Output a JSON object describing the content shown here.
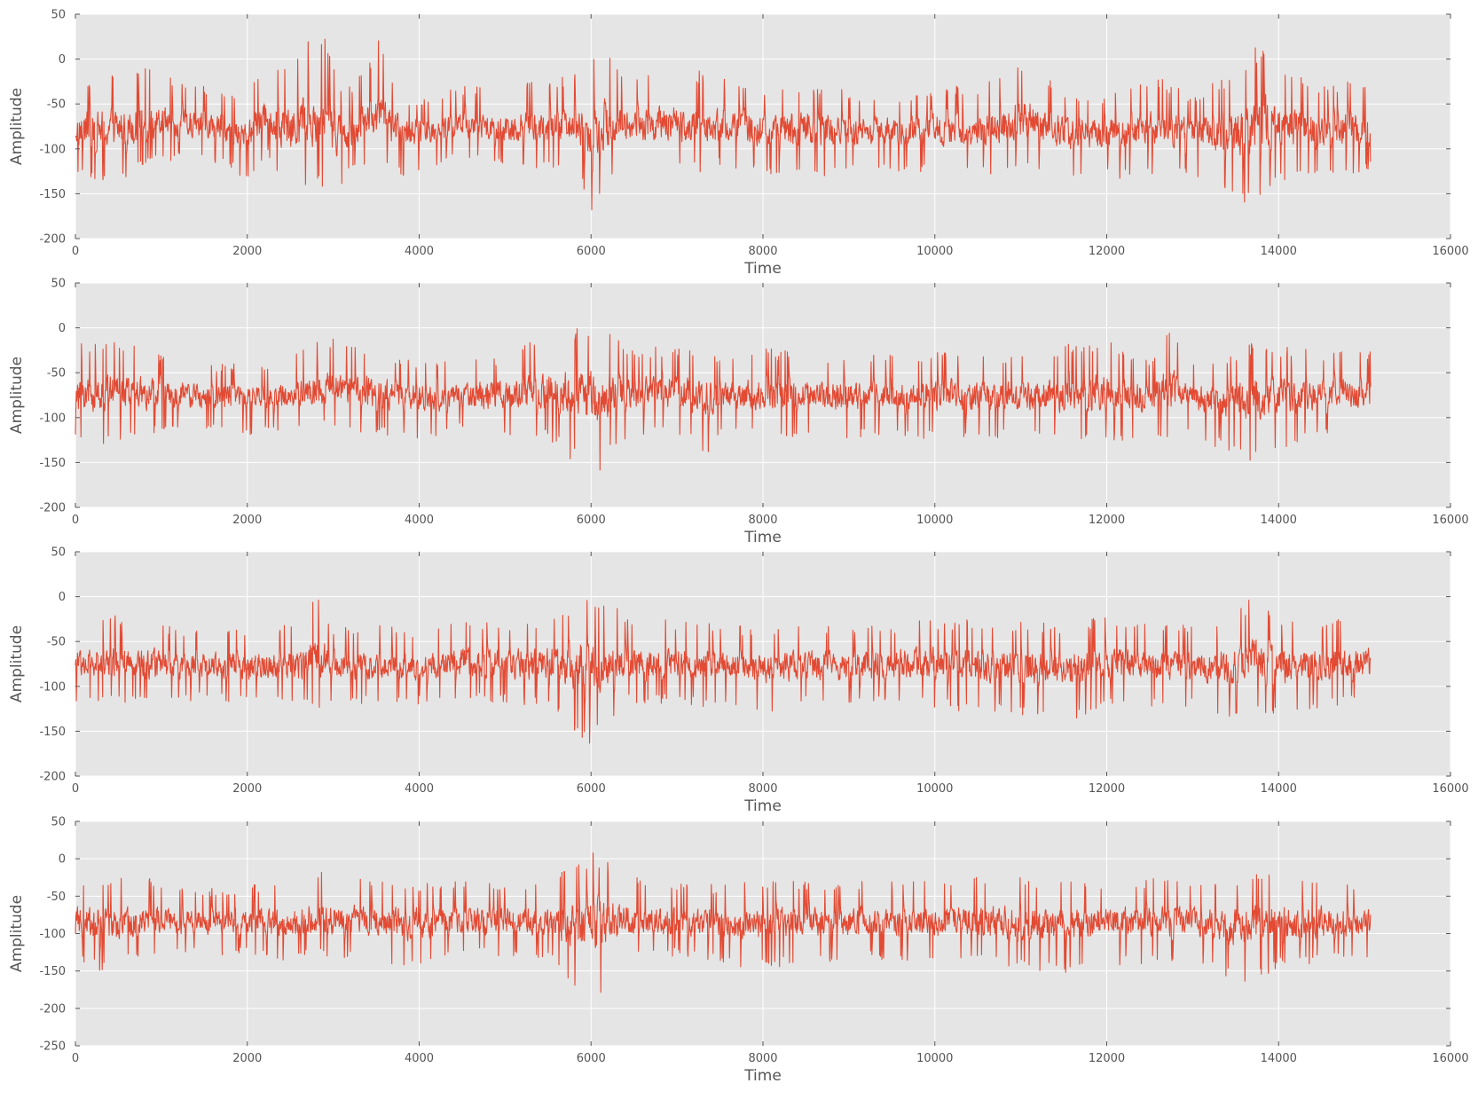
{
  "chart_data": [
    {
      "type": "line",
      "title": "",
      "xlabel": "Time",
      "ylabel": "Amplitude",
      "xlim": [
        0,
        16000
      ],
      "ylim": [
        -200,
        50
      ],
      "x_ticks": [
        0,
        2000,
        4000,
        6000,
        8000,
        10000,
        12000,
        14000,
        16000
      ],
      "y_ticks": [
        -200,
        -150,
        -100,
        -50,
        0,
        50
      ],
      "grid": true,
      "color": "#e24a33",
      "series": [
        {
          "x_range": [
            0,
            15070
          ],
          "baseline": -78,
          "envelope": [
            [
              0,
              -130,
              -28
            ],
            [
              500,
              -145,
              -8
            ],
            [
              800,
              -120,
              -10
            ],
            [
              1500,
              -110,
              -30
            ],
            [
              2000,
              -135,
              -40
            ],
            [
              2250,
              -110,
              15
            ],
            [
              2500,
              -150,
              -20
            ],
            [
              2700,
              -140,
              40
            ],
            [
              2850,
              -140,
              40
            ],
            [
              3050,
              -160,
              -20
            ],
            [
              3250,
              -120,
              -30
            ],
            [
              3520,
              -120,
              25
            ],
            [
              3800,
              -130,
              -40
            ],
            [
              4000,
              -125,
              -45
            ],
            [
              4500,
              -110,
              -30
            ],
            [
              5000,
              -120,
              -30
            ],
            [
              5500,
              -125,
              -20
            ],
            [
              5800,
              -120,
              -15
            ],
            [
              6020,
              -185,
              -10
            ],
            [
              6060,
              -160,
              20
            ],
            [
              6400,
              -120,
              -20
            ],
            [
              6950,
              -120,
              -10
            ],
            [
              7450,
              -130,
              -15
            ],
            [
              7500,
              -120,
              -10
            ],
            [
              8000,
              -130,
              -30
            ],
            [
              8500,
              -130,
              -25
            ],
            [
              9000,
              -130,
              -35
            ],
            [
              9500,
              -125,
              -40
            ],
            [
              10000,
              -130,
              -30
            ],
            [
              10500,
              -130,
              -30
            ],
            [
              11100,
              -130,
              10
            ],
            [
              11500,
              -135,
              -40
            ],
            [
              12000,
              -135,
              -40
            ],
            [
              12600,
              -130,
              -20
            ],
            [
              13000,
              -130,
              -40
            ],
            [
              13500,
              -160,
              -10
            ],
            [
              13900,
              -160,
              30
            ],
            [
              14000,
              -140,
              -10
            ],
            [
              14500,
              -135,
              -30
            ],
            [
              15070,
              -125,
              -20
            ]
          ],
          "values": [
            -90,
            -55,
            -130,
            -145,
            -30,
            -10,
            -60,
            -110,
            -30,
            -125,
            -40,
            -135,
            12,
            -150,
            38,
            38,
            -165,
            -30,
            24,
            -130,
            -45,
            -30,
            -125,
            -20,
            -185,
            22,
            -15,
            -10,
            -130,
            -40,
            -135,
            -30,
            -40,
            10,
            -135,
            -40,
            25,
            -160,
            -10,
            -145,
            -25,
            -100
          ]
        }
      ]
    },
    {
      "type": "line",
      "title": "",
      "xlabel": "Time",
      "ylabel": "Amplitude",
      "xlim": [
        0,
        16000
      ],
      "ylim": [
        -200,
        50
      ],
      "x_ticks": [
        0,
        2000,
        4000,
        6000,
        8000,
        10000,
        12000,
        14000,
        16000
      ],
      "y_ticks": [
        -200,
        -150,
        -100,
        -50,
        0,
        50
      ],
      "grid": true,
      "color": "#e24a33",
      "series": [
        {
          "x_range": [
            0,
            15070
          ],
          "baseline": -76,
          "envelope": [
            [
              0,
              -130,
              -20
            ],
            [
              300,
              -130,
              -10
            ],
            [
              800,
              -120,
              -20
            ],
            [
              1500,
              -115,
              -40
            ],
            [
              2000,
              -120,
              -40
            ],
            [
              2500,
              -115,
              -35
            ],
            [
              2830,
              -110,
              -5
            ],
            [
              3500,
              -120,
              -20
            ],
            [
              4000,
              -125,
              -40
            ],
            [
              4500,
              -115,
              -35
            ],
            [
              5000,
              -120,
              -30
            ],
            [
              5500,
              -125,
              -5
            ],
            [
              6030,
              -170,
              10
            ],
            [
              6400,
              -125,
              -20
            ],
            [
              6950,
              -115,
              -20
            ],
            [
              7350,
              -140,
              -20
            ],
            [
              7500,
              -120,
              -35
            ],
            [
              8000,
              -125,
              -20
            ],
            [
              8500,
              -120,
              -30
            ],
            [
              9000,
              -125,
              -30
            ],
            [
              9500,
              -120,
              -30
            ],
            [
              10000,
              -125,
              -25
            ],
            [
              10500,
              -125,
              -30
            ],
            [
              11000,
              -120,
              -30
            ],
            [
              11900,
              -130,
              -10
            ],
            [
              12500,
              -120,
              -35
            ],
            [
              12700,
              -125,
              10
            ],
            [
              13000,
              -120,
              -40
            ],
            [
              13500,
              -145,
              -30
            ],
            [
              13750,
              -155,
              -10
            ],
            [
              14000,
              -135,
              -20
            ],
            [
              14500,
              -120,
              -25
            ],
            [
              15070,
              -120,
              -25
            ]
          ],
          "values": [
            -130,
            -10,
            -115,
            -50,
            -120,
            -5,
            -110,
            -20,
            -125,
            -35,
            -120,
            -5,
            -170,
            10,
            -125,
            -15,
            -140,
            -35,
            -125,
            -20,
            -120,
            -30,
            -130,
            -10,
            -125,
            8,
            -145,
            -10,
            -155,
            -10,
            -135,
            -20,
            -120,
            -105
          ]
        }
      ]
    },
    {
      "type": "line",
      "title": "",
      "xlabel": "Time",
      "ylabel": "Amplitude",
      "xlim": [
        0,
        16000
      ],
      "ylim": [
        -200,
        50
      ],
      "x_ticks": [
        0,
        2000,
        4000,
        6000,
        8000,
        10000,
        12000,
        14000,
        16000
      ],
      "y_ticks": [
        -200,
        -150,
        -100,
        -50,
        0,
        50
      ],
      "grid": true,
      "color": "#e24a33",
      "series": [
        {
          "x_range": [
            0,
            15070
          ],
          "baseline": -76,
          "envelope": [
            [
              0,
              -120,
              -25
            ],
            [
              500,
              -120,
              -20
            ],
            [
              1000,
              -125,
              -30
            ],
            [
              1500,
              -115,
              -40
            ],
            [
              2000,
              -120,
              -35
            ],
            [
              2500,
              -120,
              -30
            ],
            [
              2830,
              -125,
              5
            ],
            [
              3000,
              -120,
              -35
            ],
            [
              3500,
              -120,
              -30
            ],
            [
              4000,
              -120,
              -40
            ],
            [
              4500,
              -115,
              -25
            ],
            [
              5000,
              -120,
              -30
            ],
            [
              5500,
              -125,
              -20
            ],
            [
              6030,
              -170,
              10
            ],
            [
              6400,
              -120,
              -20
            ],
            [
              7000,
              -120,
              -25
            ],
            [
              7500,
              -125,
              -30
            ],
            [
              8000,
              -130,
              -35
            ],
            [
              8500,
              -120,
              -30
            ],
            [
              9000,
              -125,
              -35
            ],
            [
              9500,
              -120,
              -30
            ],
            [
              10000,
              -125,
              -25
            ],
            [
              10500,
              -130,
              -25
            ],
            [
              11500,
              -140,
              -30
            ],
            [
              12000,
              -125,
              -20
            ],
            [
              12500,
              -125,
              -30
            ],
            [
              13000,
              -125,
              -30
            ],
            [
              13500,
              -140,
              -20
            ],
            [
              13650,
              -125,
              0
            ],
            [
              14000,
              -135,
              -20
            ],
            [
              14500,
              -125,
              -25
            ],
            [
              15070,
              -120,
              -20
            ]
          ],
          "values": [
            -120,
            -20,
            -125,
            -35,
            -120,
            5,
            -120,
            -25,
            -115,
            -20,
            -170,
            10,
            -120,
            -25,
            -130,
            -30,
            -125,
            -25,
            -140,
            -20,
            -140,
            0,
            -135,
            -20,
            -120,
            -100
          ]
        }
      ]
    },
    {
      "type": "line",
      "title": "",
      "xlabel": "Time",
      "ylabel": "Amplitude",
      "xlim": [
        0,
        16000
      ],
      "ylim": [
        -250,
        50
      ],
      "x_ticks": [
        0,
        2000,
        4000,
        6000,
        8000,
        10000,
        12000,
        14000,
        16000
      ],
      "y_ticks": [
        -250,
        -200,
        -150,
        -100,
        -50,
        0,
        50
      ],
      "grid": true,
      "color": "#e24a33",
      "series": [
        {
          "x_range": [
            0,
            15070
          ],
          "baseline": -86,
          "envelope": [
            [
              0,
              -140,
              -25
            ],
            [
              400,
              -155,
              -20
            ],
            [
              800,
              -130,
              -25
            ],
            [
              1500,
              -130,
              -40
            ],
            [
              2000,
              -130,
              -35
            ],
            [
              2500,
              -140,
              -30
            ],
            [
              2830,
              -130,
              -15
            ],
            [
              3500,
              -135,
              -30
            ],
            [
              3900,
              -150,
              -30
            ],
            [
              4500,
              -130,
              -30
            ],
            [
              5000,
              -130,
              -30
            ],
            [
              5500,
              -135,
              -30
            ],
            [
              6030,
              -200,
              10
            ],
            [
              6400,
              -135,
              -20
            ],
            [
              7000,
              -130,
              -30
            ],
            [
              7500,
              -140,
              -35
            ],
            [
              8000,
              -150,
              -25
            ],
            [
              8500,
              -140,
              -30
            ],
            [
              9000,
              -135,
              -30
            ],
            [
              9500,
              -135,
              -30
            ],
            [
              10000,
              -140,
              -25
            ],
            [
              10500,
              -140,
              -20
            ],
            [
              11500,
              -155,
              -30
            ],
            [
              12000,
              -145,
              -25
            ],
            [
              12500,
              -140,
              -25
            ],
            [
              13000,
              -140,
              -30
            ],
            [
              13500,
              -165,
              -25
            ],
            [
              13750,
              -170,
              -15
            ],
            [
              14000,
              -145,
              -20
            ],
            [
              14500,
              -140,
              -25
            ],
            [
              15070,
              -135,
              -30
            ]
          ],
          "values": [
            -140,
            -25,
            -155,
            -20,
            -130,
            -15,
            -150,
            -30,
            -200,
            10,
            -135,
            -20,
            -150,
            -25,
            -155,
            -30,
            -170,
            -15,
            -145,
            -20,
            -135,
            -110
          ]
        }
      ]
    }
  ]
}
